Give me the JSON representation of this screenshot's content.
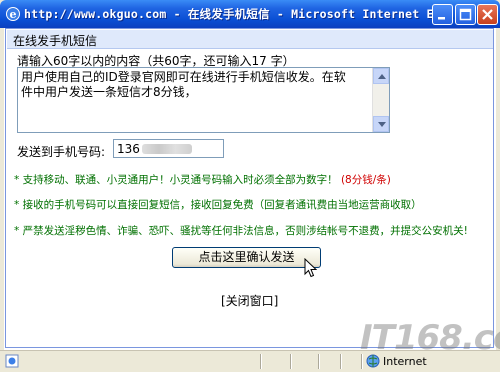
{
  "window": {
    "title": "http://www.okguo.com - 在线发手机短信 - Microsoft Internet E...",
    "icon": "ie-icon",
    "controls": [
      "minimize-icon",
      "maximize-icon",
      "close-icon"
    ]
  },
  "panel": {
    "header": "在线发手机短信",
    "prompt": "请输入60字以内的内容（共60字，还可输入17  字）",
    "message": "用户使用自己的ID登录官网即可在线进行手机短信收发。在软件中用户发送一条短信才8分钱，",
    "phone_label": "发送到手机号码:",
    "phone_value": "136",
    "notes": [
      {
        "text": "* 支持移动、联通、小灵通用户！小灵通号码输入时必须全部为数字！",
        "highlight": "(8分钱/条)"
      },
      {
        "text": "* 接收的手机号码可以直接回复短信，接收回复免费（回复者通讯费由当地运营商收取）",
        "highlight": ""
      },
      {
        "text": "* 严禁发送淫秽色情、诈骗、恐吓、骚扰等任何非法信息，否则涉结帐号不退费，并提交公安机关!",
        "highlight": ""
      }
    ],
    "send_button": "点击这里确认发送",
    "close_link": "[关闭窗口]"
  },
  "statusbar": {
    "zone": "Internet"
  },
  "watermark": "IT168.com",
  "colors": {
    "titlebar": "#0a4fd4",
    "note_green": "#007000",
    "note_red": "#d00000"
  }
}
